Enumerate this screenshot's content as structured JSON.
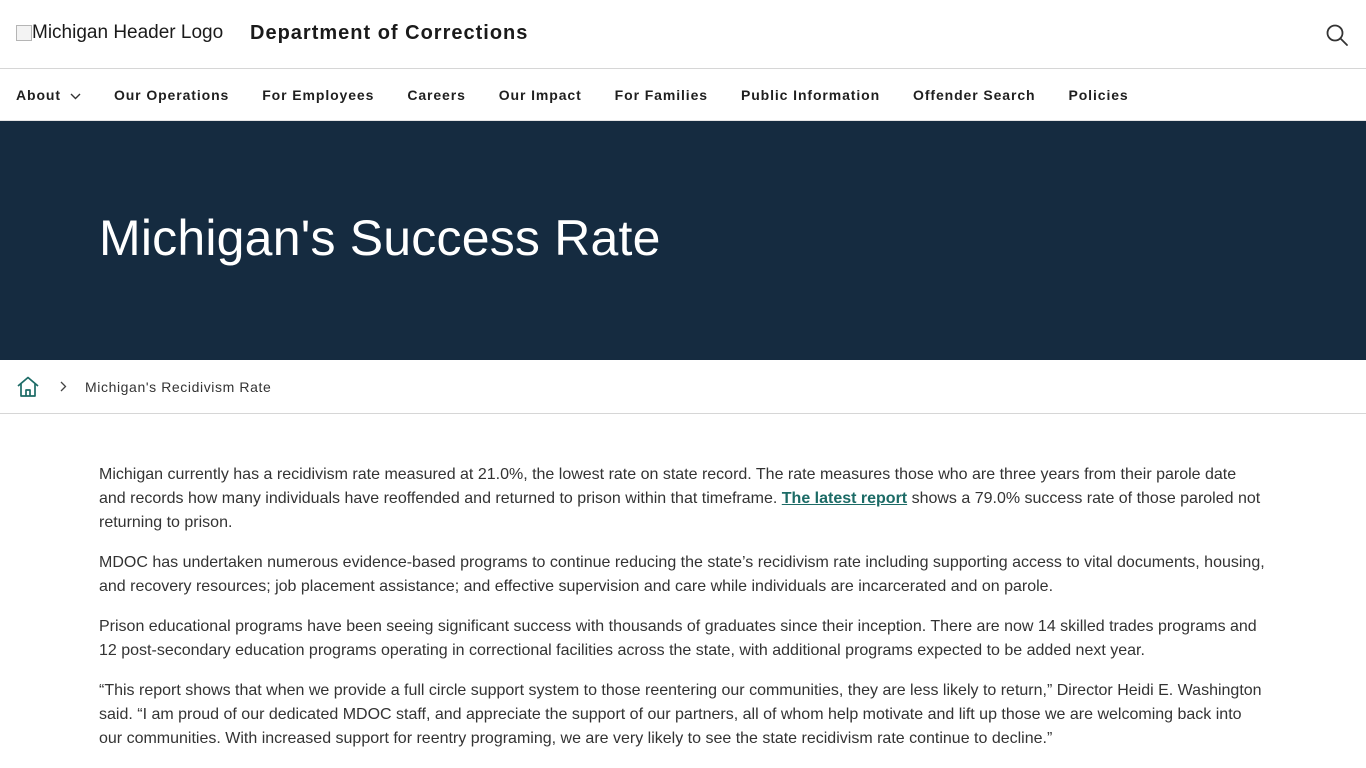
{
  "header": {
    "logo_alt": "Michigan Header Logo",
    "title": "Department of Corrections",
    "search_icon": "search-icon"
  },
  "nav": {
    "items": [
      {
        "label": "About",
        "has_dropdown": true
      },
      {
        "label": "Our Operations"
      },
      {
        "label": "For Employees"
      },
      {
        "label": "Careers"
      },
      {
        "label": "Our Impact"
      },
      {
        "label": "For Families"
      },
      {
        "label": "Public Information"
      },
      {
        "label": "Offender Search"
      },
      {
        "label": "Policies"
      }
    ]
  },
  "hero": {
    "title": "Michigan's Success Rate",
    "background": "#152b40"
  },
  "breadcrumb": {
    "home_icon": "home-icon",
    "current": "Michigan's Recidivism Rate"
  },
  "content": {
    "p1_before": "Michigan currently has a recidivism rate measured at 21.0%, the lowest rate on state record. The rate measures those who are three years from their parole date and records how many individuals have reoffended and returned to prison within that timeframe. ",
    "p1_link": "The latest report",
    "p1_after": " shows a 79.0% success rate of those paroled not returning to prison.",
    "p2": "MDOC has undertaken numerous evidence-based programs to continue reducing the state’s recidivism rate including supporting access to vital documents, housing, and recovery resources; job placement assistance; and effective supervision and care while individuals are incarcerated and on parole.",
    "p3": "Prison educational programs have been seeing significant success with thousands of graduates since their inception. There are now 14 skilled trades programs and 12 post-secondary education programs operating in correctional facilities across the state, with additional programs expected to be added next year.",
    "p4": "“This report shows that when we provide a full circle support system to those reentering our communities, they are less likely to return,” Director Heidi E. Washington said. “I am proud of our dedicated MDOC staff, and appreciate the support of our partners, all of whom help motivate and lift up those we are welcoming back into our communities. With increased support for reentry programing, we are very likely to see the state recidivism rate continue to decline.”"
  },
  "colors": {
    "link": "#1c6b66",
    "hero_bg": "#152b40",
    "home_icon": "#1c6b66"
  }
}
